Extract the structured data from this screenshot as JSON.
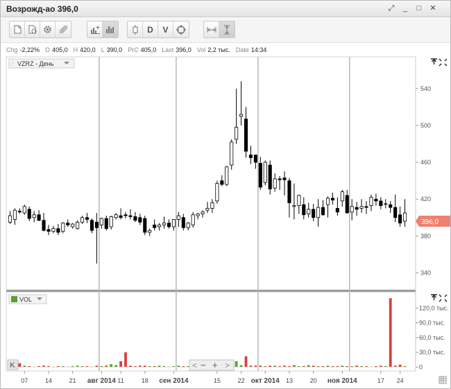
{
  "window": {
    "title": "Возрожд-ао 396,0",
    "controls": {
      "restore": "⤢",
      "minimize": "_",
      "maximize": "□",
      "close": "✕"
    }
  },
  "toolbar": {
    "group1": [
      "page-icon",
      "refresh-page-icon",
      "gear-icon",
      "draw-lines-icon"
    ],
    "group2": [
      "add-indicator-icon",
      "bars-icon"
    ],
    "group3": {
      "candle": "candlestick-icon",
      "d_label": "D",
      "v_label": "V",
      "target": "crosshair-icon"
    },
    "group4": [
      "fit-width-icon",
      "fit-height-icon"
    ]
  },
  "info": {
    "chg_label": "Chg",
    "chg_value": "-2,22%",
    "open_label": "O",
    "open_value": "405,0",
    "high_label": "H",
    "high_value": "420,0",
    "low_label": "L",
    "low_value": "390,0",
    "prc_label": "PrC",
    "prc_value": "405,0",
    "last_label": "Last",
    "last_value": "396,0",
    "vol_label": "Vol",
    "vol_value": "2,2 тыс.",
    "date_label": "Date",
    "date_value": "14:34"
  },
  "colors": {
    "up": "#ffffff",
    "down": "#000000",
    "last_price_badge": "#f08070",
    "volume_up": "#5aa02c",
    "volume_down": "#d84040",
    "grid_month": "#b8b8b8"
  },
  "chart_data": [
    {
      "type": "candlestick",
      "instrument_label": "VZRZ - День",
      "y_ticks": [
        340,
        380,
        420,
        460,
        500,
        540
      ],
      "ylim": [
        323,
        573
      ],
      "last_price": 396.0,
      "last_price_label": "396,0",
      "x_tick_labels": [
        "07",
        "14",
        "21",
        "авг 2014",
        "11",
        "18",
        "сен 2014",
        "15",
        "22",
        "окт 2014",
        "13",
        "20",
        "ноя 2014",
        "17",
        "24"
      ],
      "x_tick_index": [
        3,
        8,
        13,
        19,
        23,
        28,
        34,
        43,
        48,
        53,
        58,
        63,
        69,
        77,
        81
      ],
      "month_line_index": [
        18.5,
        34.5,
        51.5,
        70.5
      ],
      "ohlc": [
        [
          395,
          407,
          393,
          402
        ],
        [
          398,
          410,
          392,
          408
        ],
        [
          407,
          410,
          404,
          406
        ],
        [
          405,
          414,
          403,
          412
        ],
        [
          409,
          412,
          396,
          399
        ],
        [
          400,
          407,
          395,
          403
        ],
        [
          403,
          408,
          396,
          397
        ],
        [
          397,
          405,
          385,
          386
        ],
        [
          387,
          392,
          381,
          385
        ],
        [
          385,
          391,
          383,
          388
        ],
        [
          388,
          393,
          381,
          384
        ],
        [
          385,
          395,
          383,
          394
        ],
        [
          394,
          398,
          390,
          392
        ],
        [
          390,
          394,
          388,
          393
        ],
        [
          388,
          397,
          387,
          395
        ],
        [
          395,
          402,
          393,
          400
        ],
        [
          400,
          405,
          394,
          398
        ],
        [
          397,
          399,
          383,
          386
        ],
        [
          395,
          405,
          350,
          389
        ],
        [
          392,
          400,
          388,
          399
        ],
        [
          399,
          402,
          386,
          388
        ],
        [
          390,
          402,
          387,
          401
        ],
        [
          400,
          405,
          398,
          403
        ],
        [
          402,
          410,
          398,
          400
        ],
        [
          403,
          406,
          399,
          402
        ],
        [
          402,
          409,
          398,
          401
        ],
        [
          401,
          406,
          395,
          397
        ],
        [
          400,
          404,
          392,
          395
        ],
        [
          399,
          402,
          381,
          384
        ],
        [
          384,
          388,
          380,
          386
        ],
        [
          392,
          398,
          386,
          389
        ],
        [
          390,
          394,
          386,
          392
        ],
        [
          392,
          401,
          388,
          394
        ],
        [
          394,
          398,
          388,
          390
        ],
        [
          390,
          396,
          386,
          398
        ],
        [
          398,
          406,
          390,
          402
        ],
        [
          400,
          404,
          386,
          389
        ],
        [
          389,
          395,
          386,
          394
        ],
        [
          392,
          406,
          389,
          403
        ],
        [
          402,
          405,
          398,
          404
        ],
        [
          404,
          408,
          400,
          406
        ],
        [
          408,
          417,
          405,
          410
        ],
        [
          410,
          420,
          405,
          416
        ],
        [
          418,
          440,
          415,
          437
        ],
        [
          440,
          446,
          434,
          436
        ],
        [
          436,
          456,
          434,
          455
        ],
        [
          457,
          485,
          452,
          482
        ],
        [
          485,
          540,
          480,
          498
        ],
        [
          510,
          548,
          500,
          512
        ],
        [
          507,
          520,
          465,
          472
        ],
        [
          468,
          478,
          458,
          465
        ],
        [
          468,
          465,
          453,
          460
        ],
        [
          459,
          466,
          430,
          433
        ],
        [
          438,
          462,
          435,
          460
        ],
        [
          457,
          462,
          425,
          431
        ],
        [
          432,
          448,
          428,
          442
        ],
        [
          442,
          445,
          430,
          441
        ],
        [
          443,
          450,
          424,
          441
        ],
        [
          440,
          443,
          400,
          416
        ],
        [
          412,
          437,
          398,
          413
        ],
        [
          413,
          425,
          404,
          424
        ],
        [
          414,
          422,
          398,
          403
        ],
        [
          404,
          416,
          400,
          409
        ],
        [
          409,
          415,
          396,
          400
        ],
        [
          400,
          420,
          390,
          411
        ],
        [
          411,
          419,
          402,
          403
        ],
        [
          414,
          423,
          400,
          421
        ],
        [
          421,
          427,
          414,
          419
        ],
        [
          410,
          422,
          402,
          406
        ],
        [
          418,
          430,
          412,
          428
        ],
        [
          424,
          430,
          408,
          405
        ],
        [
          406,
          420,
          397,
          412
        ],
        [
          411,
          417,
          402,
          409
        ],
        [
          410,
          420,
          405,
          412
        ],
        [
          412,
          418,
          404,
          411
        ],
        [
          413,
          425,
          407,
          422
        ],
        [
          420,
          426,
          413,
          418
        ],
        [
          418,
          422,
          409,
          413
        ],
        [
          415,
          420,
          410,
          415
        ],
        [
          414,
          418,
          405,
          411
        ],
        [
          411,
          425,
          395,
          400
        ],
        [
          403,
          412,
          390,
          394
        ],
        [
          396,
          420,
          390,
          405
        ]
      ]
    },
    {
      "type": "bar",
      "series_label": "VOL",
      "y_tick_labels": [
        "0",
        "30,0 тыс.",
        "60,0 тыс.",
        "90,0 тыс.",
        "120,0 тыс."
      ],
      "y_ticks": [
        0,
        30,
        60,
        90,
        120
      ],
      "ylim": [
        -5,
        150
      ],
      "value_unit": "тыс.",
      "values": [
        3,
        2,
        8,
        3,
        2,
        1,
        2,
        3,
        2,
        1,
        2,
        2,
        1,
        2,
        3,
        2,
        2,
        1,
        3,
        2,
        3,
        6,
        4,
        12,
        30,
        3,
        2,
        3,
        3,
        2,
        2,
        3,
        2,
        1,
        2,
        3,
        2,
        2,
        3,
        2,
        5,
        6,
        8,
        10,
        8,
        15,
        6,
        12,
        4,
        22,
        3,
        3,
        3,
        2,
        3,
        3,
        2,
        3,
        2,
        4,
        2,
        2,
        4,
        3,
        2,
        2,
        3,
        2,
        2,
        3,
        2,
        2,
        3,
        2,
        2,
        1,
        2,
        3,
        2,
        140,
        3,
        5,
        2
      ]
    }
  ],
  "navigator": {
    "prev": "<",
    "minus": "−",
    "plus": "+",
    "next": ">",
    "start": "K"
  }
}
